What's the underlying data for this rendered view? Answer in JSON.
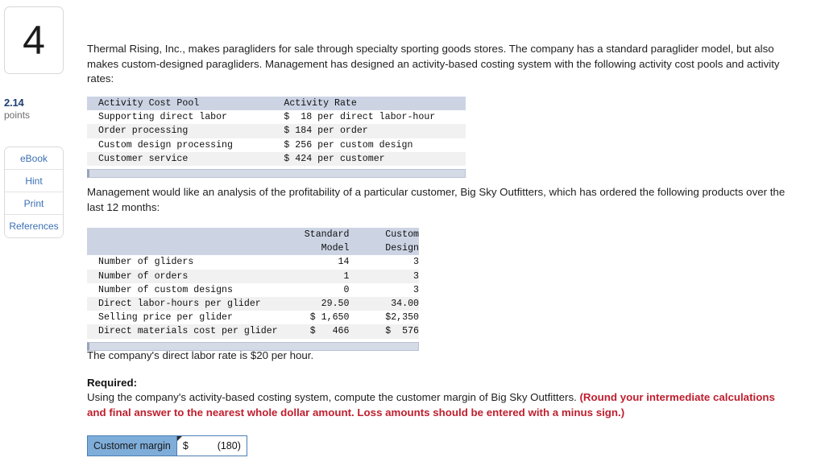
{
  "sidebar": {
    "question_number": "4",
    "points_value": "2.14",
    "points_label": "points",
    "tools": [
      {
        "label": "eBook",
        "name": "ebook"
      },
      {
        "label": "Hint",
        "name": "hint"
      },
      {
        "label": "Print",
        "name": "print"
      },
      {
        "label": "References",
        "name": "references"
      }
    ]
  },
  "content": {
    "intro_paragraph": "Thermal Rising, Inc., makes paragliders for sale through specialty sporting goods stores. The company has a standard paraglider model, but also makes custom-designed paragliders. Management has designed an activity-based costing system with the following activity cost pools and activity rates:",
    "analysis_paragraph": "Management would like an analysis of the profitability of a particular customer, Big Sky Outfitters, which has ordered the following products over the last 12 months:",
    "labor_rate_paragraph": "The company's direct labor rate is $20 per hour.",
    "required_label": "Required:",
    "required_text": "Using the company's activity-based costing system, compute the customer margin of Big Sky Outfitters. ",
    "required_red_note": "(Round your intermediate calculations and final answer to the nearest whole dollar amount. Loss amounts should be entered with a minus sign.)"
  },
  "activity_rate_table": {
    "headers": [
      "Activity Cost Pool",
      "Activity Rate"
    ],
    "rows": [
      {
        "pool": "Supporting direct labor",
        "rate": "$  18 per direct labor-hour"
      },
      {
        "pool": "Order processing",
        "rate": "$ 184 per order"
      },
      {
        "pool": "Custom design processing",
        "rate": "$ 256 per custom design"
      },
      {
        "pool": "Customer service",
        "rate": "$ 424 per customer"
      }
    ]
  },
  "customer_table": {
    "header_line1": [
      "",
      "Standard",
      "Custom"
    ],
    "header_line2": [
      "",
      "Model",
      "Design"
    ],
    "rows": [
      {
        "label": "Number of gliders",
        "standard": "14",
        "custom": "3"
      },
      {
        "label": "Number of orders",
        "standard": "1",
        "custom": "3"
      },
      {
        "label": "Number of custom designs",
        "standard": "0",
        "custom": "3"
      },
      {
        "label": "Direct labor-hours per glider",
        "standard": "29.50",
        "custom": "34.00"
      },
      {
        "label": "Selling price per glider",
        "standard": "$ 1,650",
        "custom": "$2,350"
      },
      {
        "label": "Direct materials cost per glider",
        "standard": "$   466",
        "custom": "$  576"
      }
    ]
  },
  "answer": {
    "label": "Customer margin",
    "currency": "$",
    "value": "(180)"
  },
  "colors": {
    "table_header_bg": "#ccd4e4",
    "table_stripe_bg": "#f1f1f1",
    "answer_label_bg": "#7fadd9",
    "answer_border": "#4a7fb5",
    "red_note": "#bf1e2e",
    "points_blue": "#1d3f73",
    "link_blue": "#3a6fb5"
  }
}
